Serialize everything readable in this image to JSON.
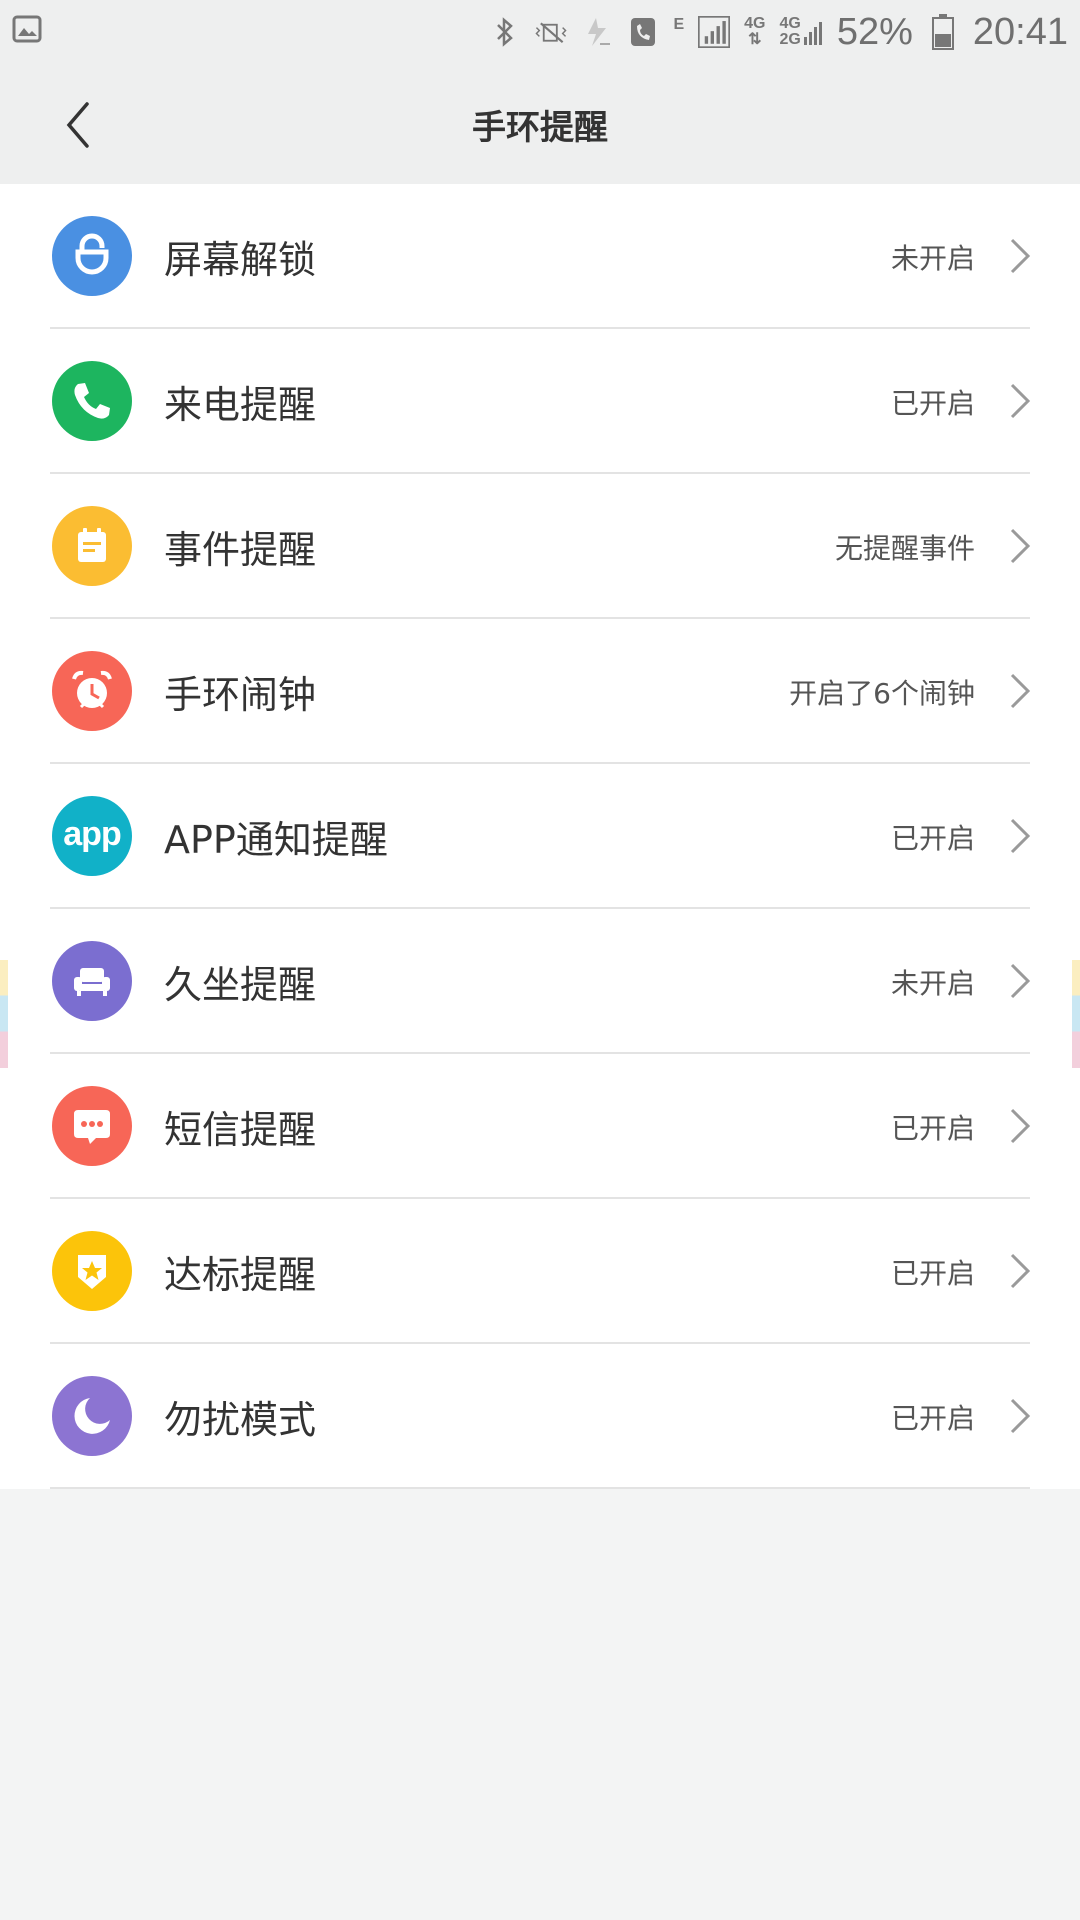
{
  "status_bar": {
    "battery": "52%",
    "time": "20:41",
    "network_top": "4G",
    "network_bottom": "2G",
    "network_main": "4G",
    "edge": "E"
  },
  "header": {
    "title": "手环提醒"
  },
  "items": [
    {
      "label": "屏幕解锁",
      "status": "未开启",
      "color": "#4a90e2",
      "icon": "unlock-icon"
    },
    {
      "label": "来电提醒",
      "status": "已开启",
      "color": "#1db55f",
      "icon": "phone-icon"
    },
    {
      "label": "事件提醒",
      "status": "无提醒事件",
      "color": "#fbbd32",
      "icon": "calendar-note-icon"
    },
    {
      "label": "手环闹钟",
      "status": "开启了6个闹钟",
      "color": "#f76657",
      "icon": "alarm-clock-icon"
    },
    {
      "label": "APP通知提醒",
      "status": "已开启",
      "color": "#11b1c8",
      "icon": "app-icon"
    },
    {
      "label": "久坐提醒",
      "status": "未开启",
      "color": "#7b6ed0",
      "icon": "sofa-icon"
    },
    {
      "label": "短信提醒",
      "status": "已开启",
      "color": "#f76657",
      "icon": "message-icon"
    },
    {
      "label": "达标提醒",
      "status": "已开启",
      "color": "#fcc40a",
      "icon": "star-badge-icon"
    },
    {
      "label": "勿扰模式",
      "status": "已开启",
      "color": "#8c74d2",
      "icon": "moon-icon"
    }
  ],
  "app_icon_text": "app"
}
